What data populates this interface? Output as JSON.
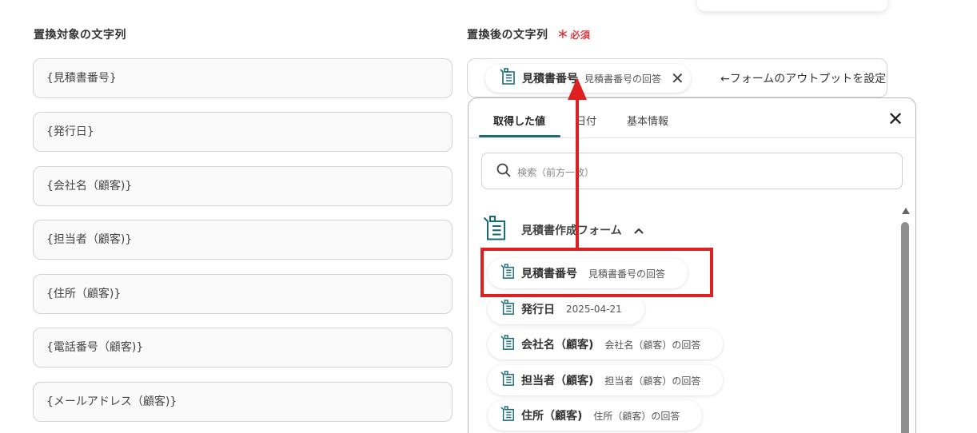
{
  "left": {
    "label": "置換対象の文字列",
    "fields": [
      "{見積書番号}",
      "{発行日}",
      "{会社名（顧客)}",
      "{担当者（顧客)}",
      "{住所（顧客)}",
      "{電話番号（顧客)}",
      "{メールアドレス（顧客)}"
    ]
  },
  "right": {
    "label": "置換後の文字列",
    "required_label": "必須",
    "required_mark": "＊",
    "chip": {
      "name": "見積書番号",
      "desc": "見積書番号の回答",
      "close": "✕"
    },
    "after_text": "←フォームのアウトプットを設定"
  },
  "dropdown": {
    "tabs": [
      "取得した値",
      "日付",
      "基本情報"
    ],
    "active_tab": "取得した値",
    "close": "✕",
    "search_placeholder": "検索（前方一致）",
    "group_title": "見積書作成フォーム",
    "items": [
      {
        "name": "見積書番号",
        "desc": "見積書番号の回答"
      },
      {
        "name": "発行日",
        "desc": "2025-04-21"
      },
      {
        "name": "会社名（顧客)",
        "desc": "会社名（顧客）の回答"
      },
      {
        "name": "担当者（顧客)",
        "desc": "担当者（顧客）の回答"
      },
      {
        "name": "住所（顧客)",
        "desc": "住所（顧客）の回答"
      }
    ]
  },
  "annotation": {
    "color": "#e02020",
    "accent": "#1a6b78"
  }
}
